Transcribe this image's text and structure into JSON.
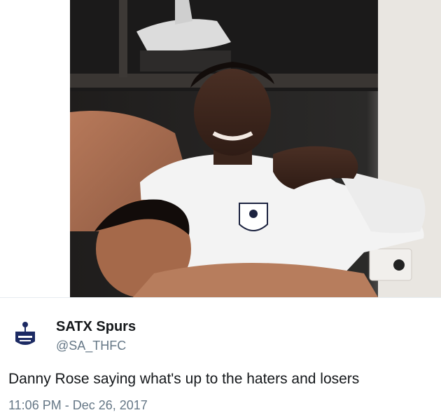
{
  "tweet": {
    "display_name": "SATX Spurs",
    "handle": "@SA_THFC",
    "text": "Danny Rose saying what's up to the haters and losers",
    "timestamp": "11:06 PM - Dec 26, 2017"
  },
  "media": {
    "icon": "photo-locker-room"
  },
  "avatar": {
    "icon": "spurs-crest-icon"
  },
  "colors": {
    "text_primary": "#14171a",
    "text_secondary": "#657786",
    "divider": "#e6ecf0"
  }
}
